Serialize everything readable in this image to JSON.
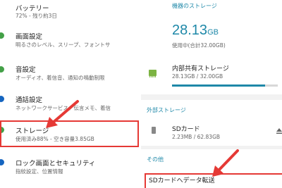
{
  "left_panel": {
    "items": [
      {
        "title": "バッテリー",
        "subtitle": "72% - 残り約3日"
      },
      {
        "title": "画面設定",
        "subtitle": "明るさのレベル、スリープ、フォントサ"
      },
      {
        "title": "音設定",
        "subtitle": "オーディオ、着信音、通知の鳴動制限"
      },
      {
        "title": "通話設定",
        "subtitle": "ネットワークサービス、伝言メモ、着信"
      },
      {
        "title": "ストレージ",
        "subtitle": "使用済み88% - 空き容量3.85GB"
      },
      {
        "title": "ロック画面とセキュリティ",
        "subtitle": "指紋設定、位置情報"
      }
    ]
  },
  "right_panel": {
    "device_storage_header": "機器のストレージ",
    "used_amount": "28.13",
    "used_unit": "GB",
    "used_caption": "使用中(合計32.00GB)",
    "internal": {
      "title": "内部共有ストレージ",
      "subtitle": "28.13GB / 32.00GB",
      "fill_percent": 88
    },
    "external_header": "外部ストレージ",
    "sd": {
      "title": "SDカード",
      "subtitle": "2.23MB / 62.83GB"
    },
    "other_header": "その他",
    "transfer": {
      "title": "SDカードへデータ転送"
    }
  },
  "colors": {
    "accent": "#1e88a8",
    "highlight": "#e53935"
  }
}
